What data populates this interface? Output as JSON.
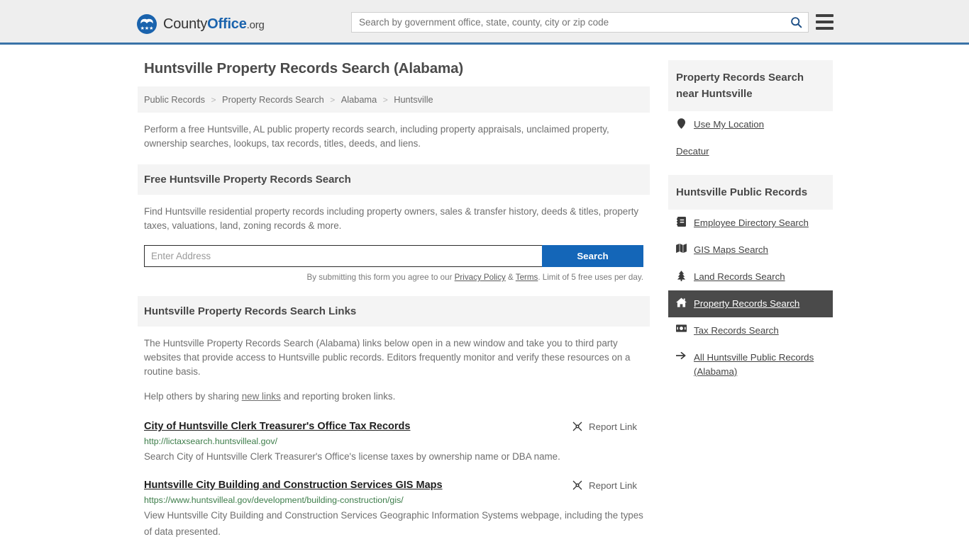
{
  "header": {
    "logo": {
      "part1": "County",
      "part2": "Office",
      "part3": ".org"
    },
    "search": {
      "placeholder": "Search by government office, state, county, city or zip code",
      "value": ""
    },
    "search_icon": "search-icon",
    "menu_icon": "hamburger-menu-icon"
  },
  "page": {
    "title": "Huntsville Property Records Search (Alabama)",
    "breadcrumb": [
      "Public Records",
      "Property Records Search",
      "Alabama",
      "Huntsville"
    ],
    "breadcrumb_separator": ">",
    "intro": "Perform a free Huntsville, AL public property records search, including property appraisals, unclaimed property, ownership searches, lookups, tax records, titles, deeds, and liens."
  },
  "free_search": {
    "heading": "Free Huntsville Property Records Search",
    "description": "Find Huntsville residential property records including property owners, sales & transfer history, deeds & titles, property taxes, valuations, land, zoning records & more.",
    "input_placeholder": "Enter Address",
    "input_value": "",
    "button_label": "Search",
    "note_prefix": "By submitting this form you agree to our ",
    "note_privacy": "Privacy Policy",
    "note_amp": " & ",
    "note_terms": "Terms",
    "note_suffix": ". Limit of 5 free uses per day."
  },
  "links_section": {
    "heading": "Huntsville Property Records Search Links",
    "description": "The Huntsville Property Records Search (Alabama) links below open in a new window and take you to third party websites that provide access to Huntsville public records. Editors frequently monitor and verify these resources on a routine basis.",
    "help_prefix": "Help others by sharing ",
    "help_link": "new links",
    "help_suffix": " and reporting broken links.",
    "report_label": "Report Link",
    "report_icon": "broken-link-icon",
    "results": [
      {
        "title": "City of Huntsville Clerk Treasurer's Office Tax Records",
        "url": "http://lictaxsearch.huntsvilleal.gov/",
        "description": "Search City of Huntsville Clerk Treasurer's Office's license taxes by ownership name or DBA name."
      },
      {
        "title": "Huntsville City Building and Construction Services GIS Maps",
        "url": "https://www.huntsvilleal.gov/development/building-construction/gis/",
        "description": "View Huntsville City Building and Construction Services Geographic Information Systems webpage, including the types of data presented."
      }
    ]
  },
  "sidebar": {
    "near": {
      "heading": "Property Records Search near Huntsville",
      "items": [
        {
          "label": "Use My Location",
          "icon": "map-pin-icon"
        },
        {
          "label": "Decatur",
          "icon": "none"
        }
      ]
    },
    "public_records": {
      "heading": "Huntsville Public Records",
      "items": [
        {
          "label": "Employee Directory Search",
          "icon": "address-book-icon",
          "active": false
        },
        {
          "label": "GIS Maps Search",
          "icon": "map-icon",
          "active": false
        },
        {
          "label": "Land Records Search",
          "icon": "tree-icon",
          "active": false
        },
        {
          "label": "Property Records Search",
          "icon": "home-icon",
          "active": true
        },
        {
          "label": "Tax Records Search",
          "icon": "money-bill-icon",
          "active": false
        },
        {
          "label": "All Huntsville Public Records (Alabama)",
          "icon": "arrow-right-icon",
          "active": false
        }
      ]
    }
  },
  "colors": {
    "brand_blue": "#1a63ad",
    "header_rule": "#3a73a8",
    "button_blue": "#1466b8",
    "url_green": "#3d7d4a",
    "active_gray": "#4a4a4a",
    "panel_gray": "#f4f4f4"
  }
}
